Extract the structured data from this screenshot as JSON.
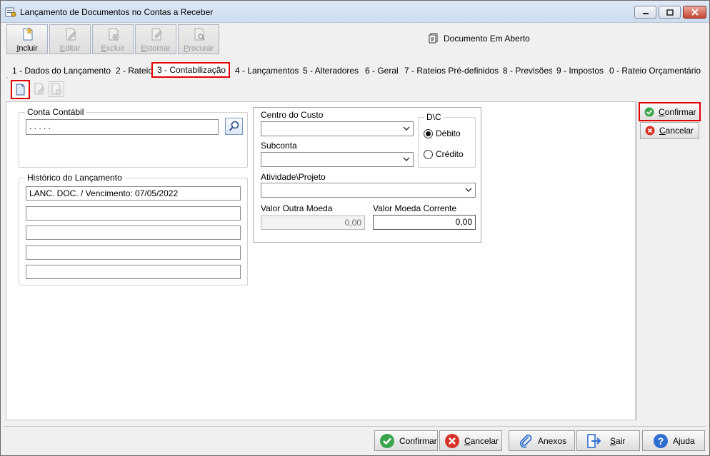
{
  "window": {
    "title": "Lançamento de Documentos no Contas a Receber",
    "controls": {
      "minimize": "minimize-icon",
      "maximize": "maximize-icon",
      "close": "close-icon"
    }
  },
  "toolbar": {
    "buttons": [
      {
        "label_underlined": "I",
        "label_rest": "ncluir",
        "icon": "new-document-icon",
        "enabled": true
      },
      {
        "label_underlined": "E",
        "label_rest": "ditar",
        "icon": "edit-document-icon",
        "enabled": false
      },
      {
        "label_underlined": "E",
        "label_rest": "xcluir",
        "icon": "delete-document-icon",
        "enabled": false
      },
      {
        "label_underlined": "E",
        "label_rest": "stornar",
        "icon": "reverse-document-icon",
        "enabled": false
      },
      {
        "label_underlined": "P",
        "label_rest": "rocurar",
        "icon": "search-document-icon",
        "enabled": false
      }
    ]
  },
  "document_status": "Documento Em Aberto",
  "tabs": [
    {
      "label": "1 - Dados do Lançamento"
    },
    {
      "label": "2 - Rateio"
    },
    {
      "label": "3 - Contabilização",
      "active": true
    },
    {
      "label": "4 - Lançamentos"
    },
    {
      "label": "5 - Alteradores"
    },
    {
      "label": "6 - Geral"
    },
    {
      "label": "7 - Rateios Pré-definidos"
    },
    {
      "label": "8 - Previsões"
    },
    {
      "label": "9 - Impostos"
    },
    {
      "label": "0 - Rateio Orçamentário"
    }
  ],
  "form": {
    "conta_contabil": {
      "label": "Conta Contábil",
      "value": ". . . . ."
    },
    "historico": {
      "label": "Histórico do Lançamento",
      "lines": [
        "LANC. DOC. /  Vencimento: 07/05/2022",
        "",
        "",
        "",
        ""
      ]
    },
    "centro_custo": {
      "label": "Centro do Custo",
      "value": ""
    },
    "subconta": {
      "label": "Subconta",
      "value": ""
    },
    "atividade_projeto": {
      "label": "Atividade\\Projeto",
      "value": ""
    },
    "dc": {
      "label": "D\\C",
      "options": [
        {
          "label": "Débito",
          "selected": true
        },
        {
          "label": "Crédito",
          "selected": false
        }
      ]
    },
    "valor_outra_moeda": {
      "label": "Valor Outra Moeda",
      "value": "0,00"
    },
    "valor_moeda_corrente": {
      "label": "Valor Moeda Corrente",
      "value": "0,00"
    }
  },
  "side": {
    "confirm": {
      "underlined": "C",
      "rest": "onfirmar"
    },
    "cancel": {
      "underlined": "C",
      "rest": "ancelar"
    }
  },
  "bottom": {
    "confirmar": {
      "underlined": "",
      "rest": "Confirmar"
    },
    "cancelar": {
      "underlined": "C",
      "rest": "ancelar"
    },
    "anexos": {
      "underlined": "",
      "rest": "Anexos"
    },
    "sair": {
      "underlined": "S",
      "rest": "air"
    },
    "ajuda": {
      "underlined": "",
      "rest": "Ajuda"
    }
  },
  "colors": {
    "highlight": "#e00000",
    "confirm_green": "#3aa54a",
    "cancel_red": "#d8332b",
    "help_blue": "#2f6fcf"
  }
}
